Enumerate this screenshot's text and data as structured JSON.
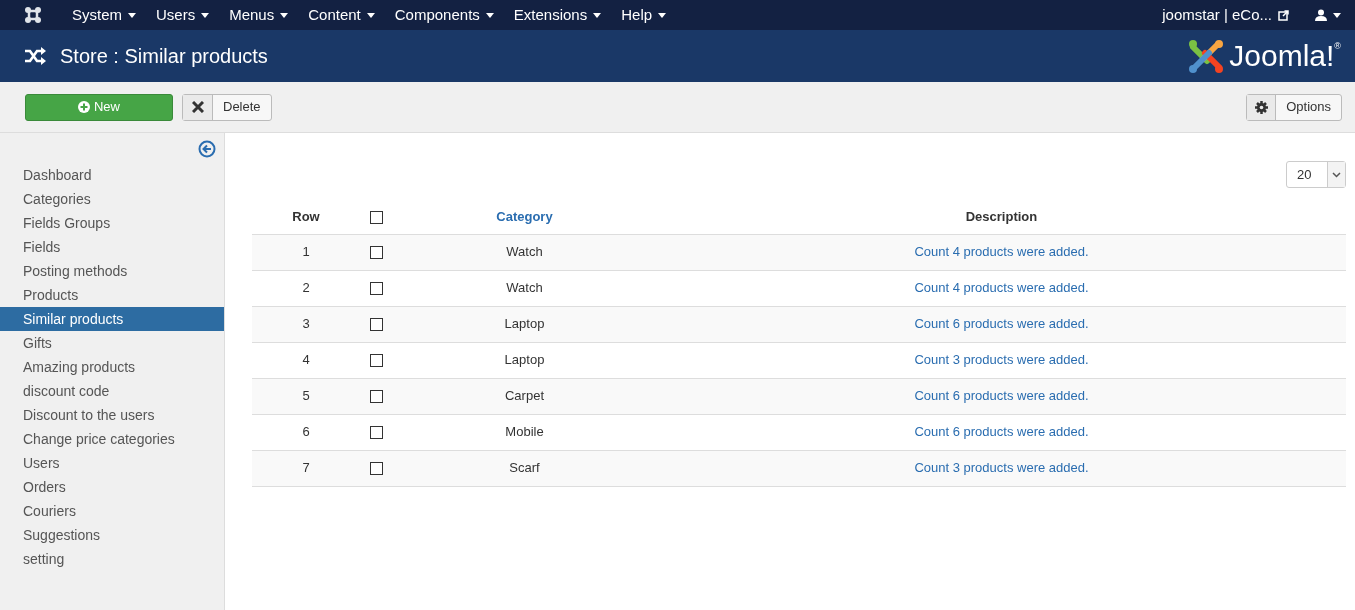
{
  "top_menu": [
    {
      "label": "System"
    },
    {
      "label": "Users"
    },
    {
      "label": "Menus"
    },
    {
      "label": "Content"
    },
    {
      "label": "Components"
    },
    {
      "label": "Extensions"
    },
    {
      "label": "Help"
    }
  ],
  "site_link": "joomstar | eCo...",
  "header": {
    "title": "Store : Similar products",
    "logo_text": "Joomla!",
    "logo_mark": "®"
  },
  "toolbar": {
    "new_label": "New",
    "delete_label": "Delete",
    "options_label": "Options"
  },
  "sidebar": {
    "items": [
      {
        "label": "Dashboard",
        "selected": false
      },
      {
        "label": "Categories",
        "selected": false
      },
      {
        "label": "Fields Groups",
        "selected": false
      },
      {
        "label": "Fields",
        "selected": false
      },
      {
        "label": "Posting methods",
        "selected": false
      },
      {
        "label": "Products",
        "selected": false
      },
      {
        "label": "Similar products",
        "selected": true
      },
      {
        "label": "Gifts",
        "selected": false
      },
      {
        "label": "Amazing products",
        "selected": false
      },
      {
        "label": "discount code",
        "selected": false
      },
      {
        "label": "Discount to the users",
        "selected": false
      },
      {
        "label": "Change price categories",
        "selected": false
      },
      {
        "label": "Users",
        "selected": false
      },
      {
        "label": "Orders",
        "selected": false
      },
      {
        "label": "Couriers",
        "selected": false
      },
      {
        "label": "Suggestions",
        "selected": false
      },
      {
        "label": "setting",
        "selected": false
      }
    ]
  },
  "list_limit": "20",
  "table": {
    "columns": [
      "Row",
      "Category",
      "Description"
    ],
    "all_checked": false,
    "rows": [
      {
        "row": "1",
        "checked": false,
        "category": "Watch",
        "description": "Count 4 products were added."
      },
      {
        "row": "2",
        "checked": false,
        "category": "Watch",
        "description": "Count 4 products were added."
      },
      {
        "row": "3",
        "checked": false,
        "category": "Laptop",
        "description": "Count 6 products were added."
      },
      {
        "row": "4",
        "checked": false,
        "category": "Laptop",
        "description": "Count 3 products were added."
      },
      {
        "row": "5",
        "checked": false,
        "category": "Carpet",
        "description": "Count 6 products were added."
      },
      {
        "row": "6",
        "checked": false,
        "category": "Mobile",
        "description": "Count 6 products were added."
      },
      {
        "row": "7",
        "checked": false,
        "category": "Scarf",
        "description": "Count 3 products were added."
      }
    ]
  }
}
